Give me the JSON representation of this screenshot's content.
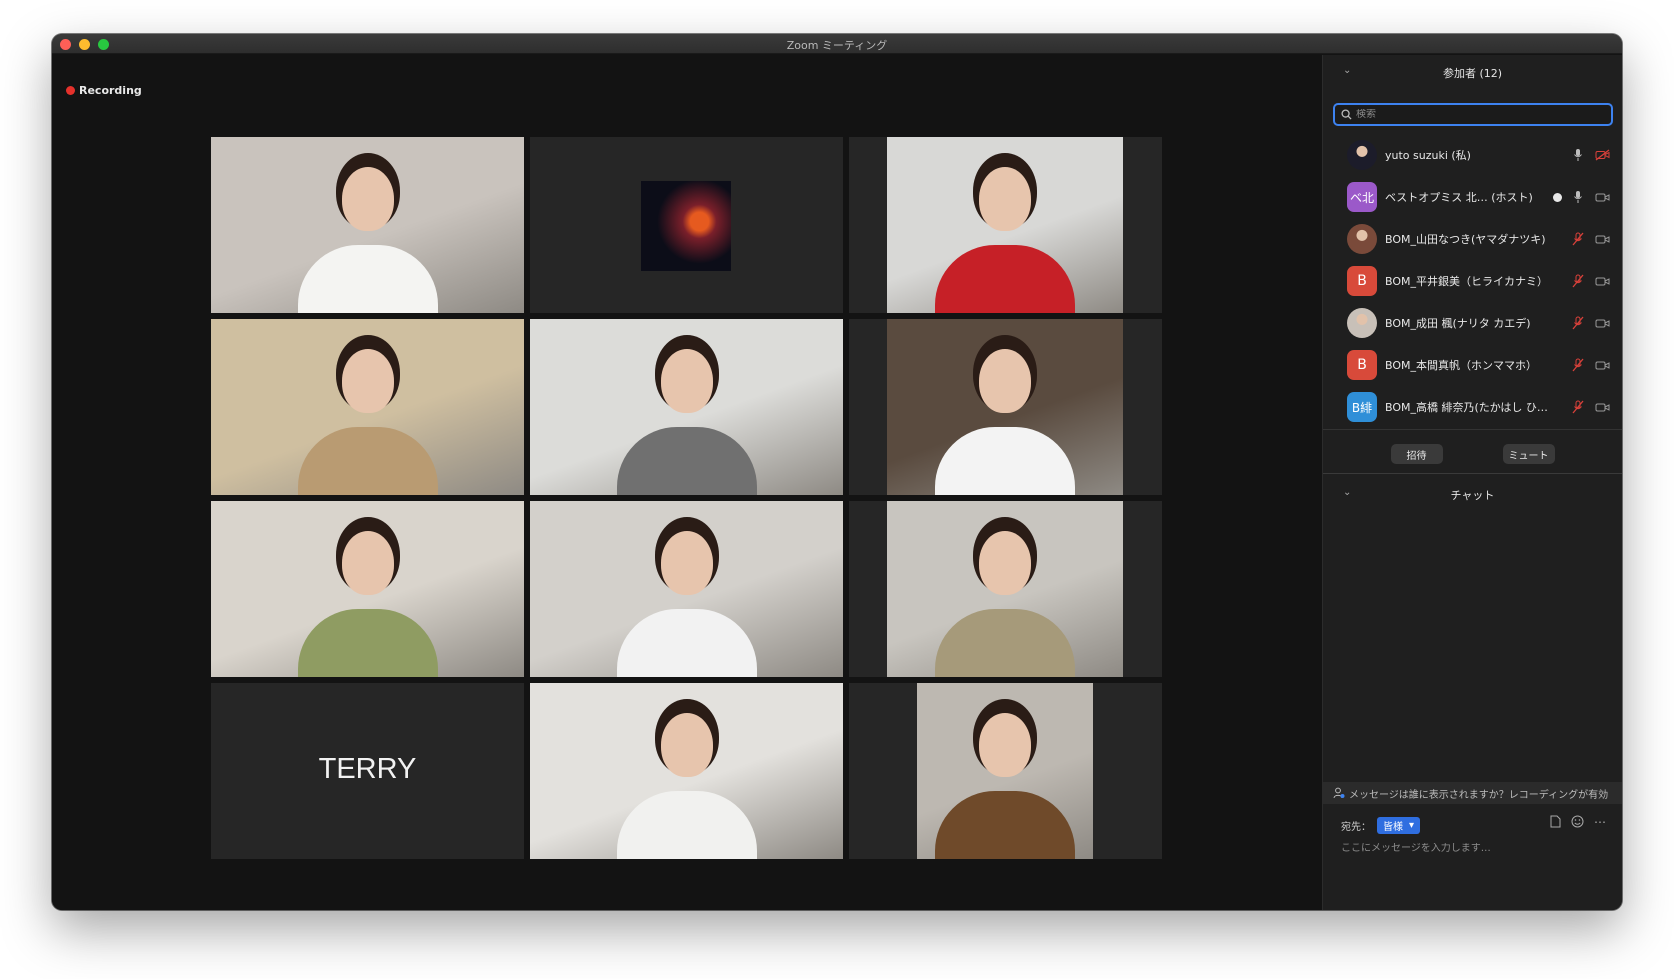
{
  "window": {
    "title": "Zoom ミーティング"
  },
  "recording": {
    "label": "Recording"
  },
  "tiles": [
    {
      "id": "t1",
      "name": "",
      "kind": "video",
      "active": true,
      "bg": "#c9c3bd",
      "accent": "#f4f4f2"
    },
    {
      "id": "t2",
      "name": "",
      "kind": "avatar",
      "bg": "#0c0d18",
      "accent": "#e65a1f"
    },
    {
      "id": "t3",
      "name": "",
      "kind": "video",
      "bg": "#d8d8d6",
      "accent": "#c62027"
    },
    {
      "id": "t4",
      "name": "",
      "kind": "video",
      "bg": "#cfbfa0",
      "accent": "#b99b72"
    },
    {
      "id": "t5",
      "name": "",
      "kind": "video",
      "bg": "#dcdcd9",
      "accent": "#707070"
    },
    {
      "id": "t6",
      "name": "",
      "kind": "video",
      "bg": "#5a4b3f",
      "accent": "#f3f3f3"
    },
    {
      "id": "t7",
      "name": "",
      "kind": "video",
      "bg": "#d9d4cc",
      "accent": "#8f9c62"
    },
    {
      "id": "t8",
      "name": "",
      "kind": "video",
      "bg": "#d3d0cb",
      "accent": "#f2f2f2"
    },
    {
      "id": "t9",
      "name": "",
      "kind": "video",
      "bg": "#c8c5bf",
      "accent": "#a69a7a"
    },
    {
      "id": "t10",
      "name": "TERRY",
      "kind": "name"
    },
    {
      "id": "t11",
      "name": "",
      "kind": "video",
      "bg": "#e3e1dd",
      "accent": "#f1f1ef"
    },
    {
      "id": "t12",
      "name": "",
      "kind": "video",
      "bg": "#bdb8b1",
      "accent": "#6f4a2a"
    }
  ],
  "participants": {
    "header": "参加者 (12)",
    "search_placeholder": "検索",
    "invite_label": "招待",
    "mute_label": "ミュート",
    "list": [
      {
        "name": "yuto suzuki (私)",
        "avatar_text": "",
        "avatar_color": "#1c1c2a",
        "mic": "on",
        "video": "off",
        "host": false
      },
      {
        "name": "ベストオプミス 北…  (ホスト)",
        "avatar_text": "ベ北",
        "avatar_color": "#9b59c9",
        "mic": "on",
        "video": "on",
        "host": true
      },
      {
        "name": "BOM_山田なつき(ヤマダナツキ)",
        "avatar_text": "",
        "avatar_color": "#7a4a3a",
        "mic": "muted",
        "video": "on",
        "host": false
      },
      {
        "name": "BOM_平井銀美（ヒライカナミ）",
        "avatar_text": "B",
        "avatar_color": "#d84a3a",
        "mic": "muted",
        "video": "on",
        "host": false
      },
      {
        "name": "BOM_成田 楓(ナリタ カエデ)",
        "avatar_text": "",
        "avatar_color": "#c8c0b8",
        "mic": "muted",
        "video": "on",
        "host": false
      },
      {
        "name": "BOM_本間真帆（ホンママホ）",
        "avatar_text": "B",
        "avatar_color": "#d84a3a",
        "mic": "muted",
        "video": "on",
        "host": false
      },
      {
        "name": "BOM_高橋 緋奈乃(たかはし ひ…",
        "avatar_text": "B緋",
        "avatar_color": "#2f8fd8",
        "mic": "muted",
        "video": "on",
        "host": false
      }
    ]
  },
  "chat": {
    "header": "チャット",
    "info": "メッセージは誰に表示されますか？レコーディングが有効",
    "to_label": "宛先：",
    "to_value": "皆様",
    "input_placeholder": "ここにメッセージを入力します…"
  }
}
